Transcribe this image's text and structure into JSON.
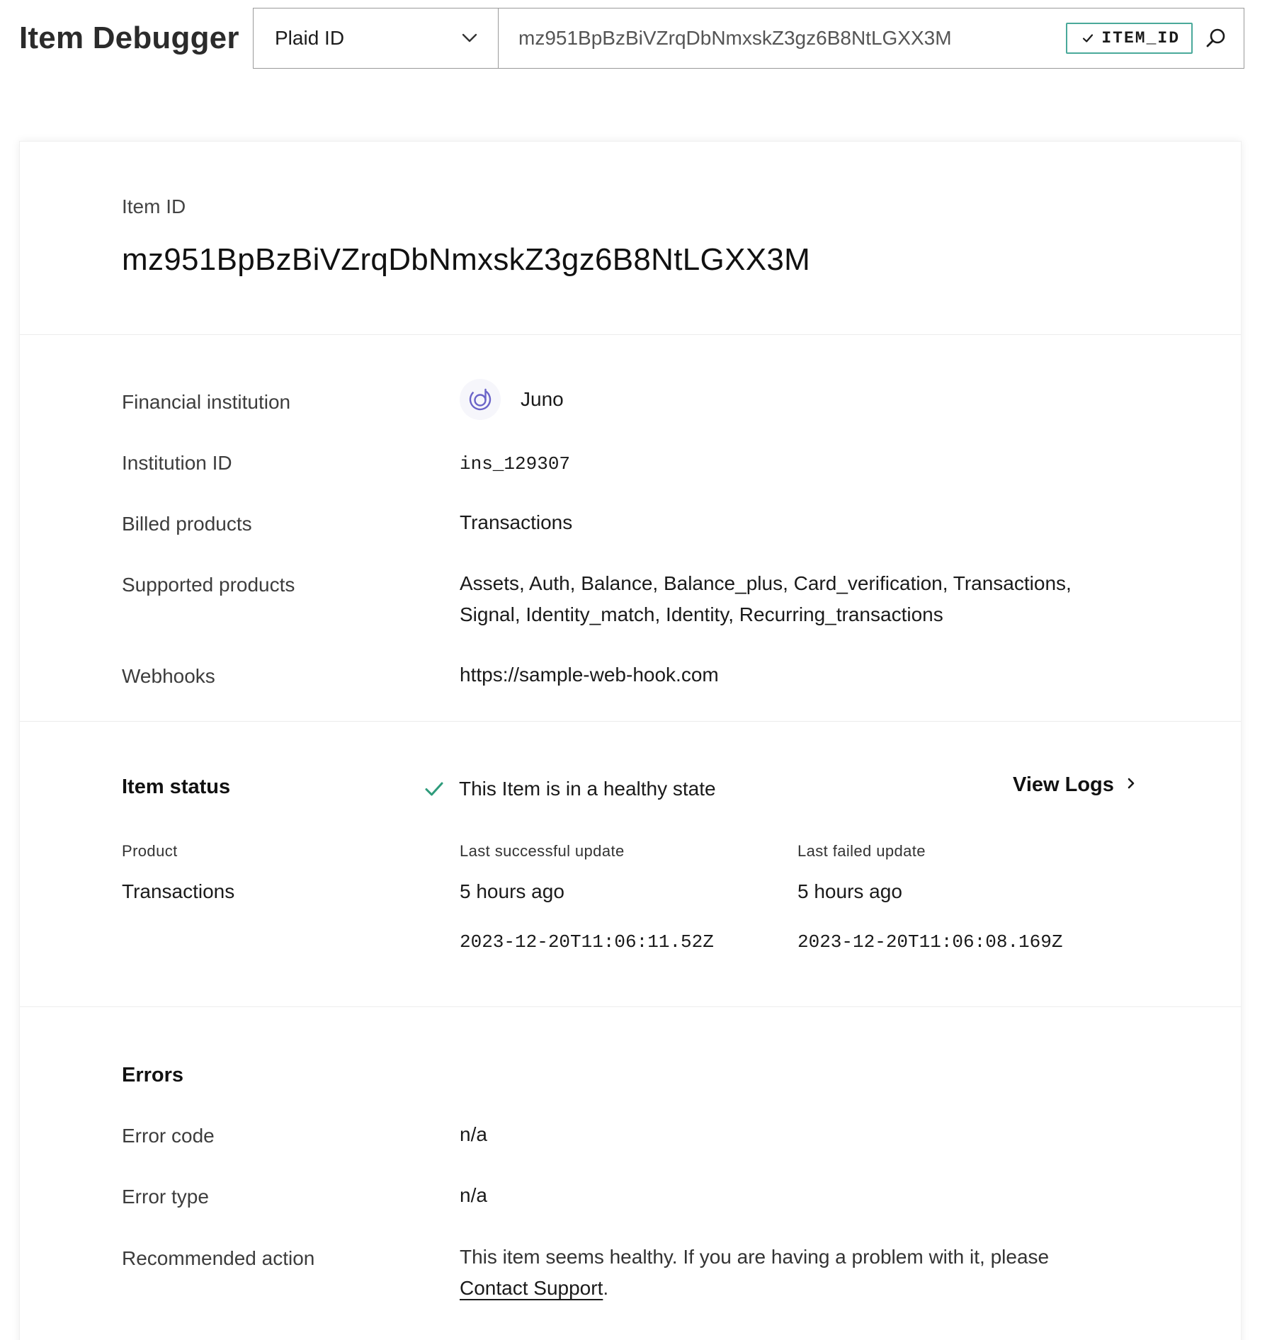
{
  "header": {
    "title": "Item Debugger",
    "id_type_selected": "Plaid ID",
    "search_value": "mz951BpBzBiVZrqDbNmxskZ3gz6B8NtLGXX3M",
    "detected_badge": "ITEM_ID"
  },
  "item": {
    "id_label": "Item ID",
    "id_value": "mz951BpBzBiVZrqDbNmxskZ3gz6B8NtLGXX3M"
  },
  "details": {
    "institution_label": "Financial institution",
    "institution_name": "Juno",
    "institution_id_label": "Institution ID",
    "institution_id": "ins_129307",
    "billed_label": "Billed products",
    "billed_value": "Transactions",
    "supported_label": "Supported products",
    "supported_line1": "Assets, Auth, Balance, Balance_plus, Card_verification, Transactions,",
    "supported_line2": "Signal, Identity_match, Identity, Recurring_transactions",
    "webhooks_label": "Webhooks",
    "webhooks_value": "https://sample-web-hook.com"
  },
  "status": {
    "heading": "Item status",
    "message": "This Item is in a healthy state",
    "view_logs": "View Logs",
    "columns": {
      "product": "Product",
      "last_success": "Last successful update",
      "last_failed": "Last failed update"
    },
    "rows": [
      {
        "product": "Transactions",
        "success_relative": "5 hours ago",
        "success_timestamp": "2023-12-20T11:06:11.52Z",
        "failed_relative": "5 hours ago",
        "failed_timestamp": "2023-12-20T11:06:08.169Z"
      }
    ]
  },
  "errors": {
    "heading": "Errors",
    "code_label": "Error code",
    "code_value": "n/a",
    "type_label": "Error type",
    "type_value": "n/a",
    "action_label": "Recommended action",
    "action_text": "This item seems healthy. If you are having a problem with it, please",
    "action_link": "Contact Support",
    "action_suffix": "."
  },
  "colors": {
    "accent_teal": "#4aa99a",
    "healthy_green": "#2e9b7b",
    "institution_logo": "#6a63c8"
  },
  "icons": [
    "chevron-down-icon",
    "check-icon",
    "search-icon",
    "juno-logo-icon",
    "healthy-check-icon",
    "chevron-right-icon"
  ]
}
